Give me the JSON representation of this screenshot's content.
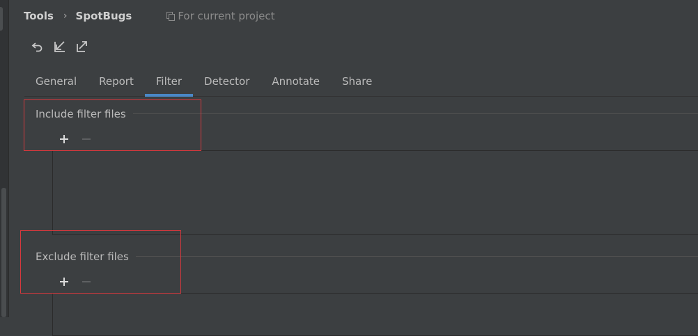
{
  "breadcrumb": {
    "parent": "Tools",
    "separator": "›",
    "current": "SpotBugs",
    "scope": "For current project"
  },
  "toolbar": {
    "buttons": [
      "undo-icon",
      "import-icon",
      "export-icon"
    ]
  },
  "tabs": [
    {
      "label": "General",
      "active": false
    },
    {
      "label": "Report",
      "active": false
    },
    {
      "label": "Filter",
      "active": true
    },
    {
      "label": "Detector",
      "active": false
    },
    {
      "label": "Annotate",
      "active": false
    },
    {
      "label": "Share",
      "active": false
    }
  ],
  "include_section": {
    "title": "Include filter files",
    "add": "+",
    "remove": "−"
  },
  "exclude_section": {
    "title": "Exclude filter files",
    "add": "+",
    "remove": "−"
  },
  "colors": {
    "background": "#3c3f41",
    "text": "#bbbbbb",
    "active_tab_underline": "#4a88c7",
    "highlight_box": "#d8383d"
  }
}
